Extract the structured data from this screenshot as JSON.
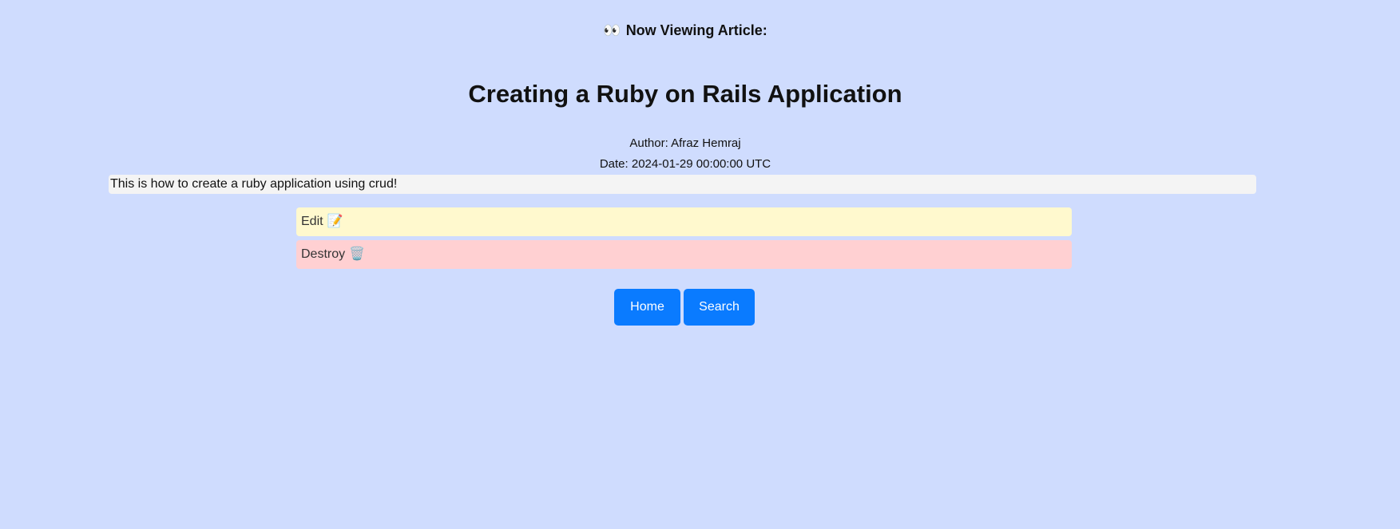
{
  "header": {
    "icon": "eyes-icon",
    "icon_glyph": "👀",
    "label": "Now Viewing Article:"
  },
  "article": {
    "title": "Creating a Ruby on Rails Application",
    "author": "Author: Afraz Hemraj",
    "date": "Date: 2024-01-29 00:00:00 UTC",
    "body": "This is how to create a ruby application using crud!"
  },
  "actions": {
    "edit_label": "Edit",
    "edit_icon": "memo-icon",
    "edit_glyph": "📝",
    "destroy_label": "Destroy",
    "destroy_icon": "wastebasket-icon",
    "destroy_glyph": "🗑️"
  },
  "nav": {
    "home_label": "Home",
    "search_label": "Search"
  },
  "colors": {
    "background": "#cfdcfe",
    "edit_bg": "#fff9ce",
    "destroy_bg": "#ffd0d2",
    "button": "#0a7bff"
  }
}
